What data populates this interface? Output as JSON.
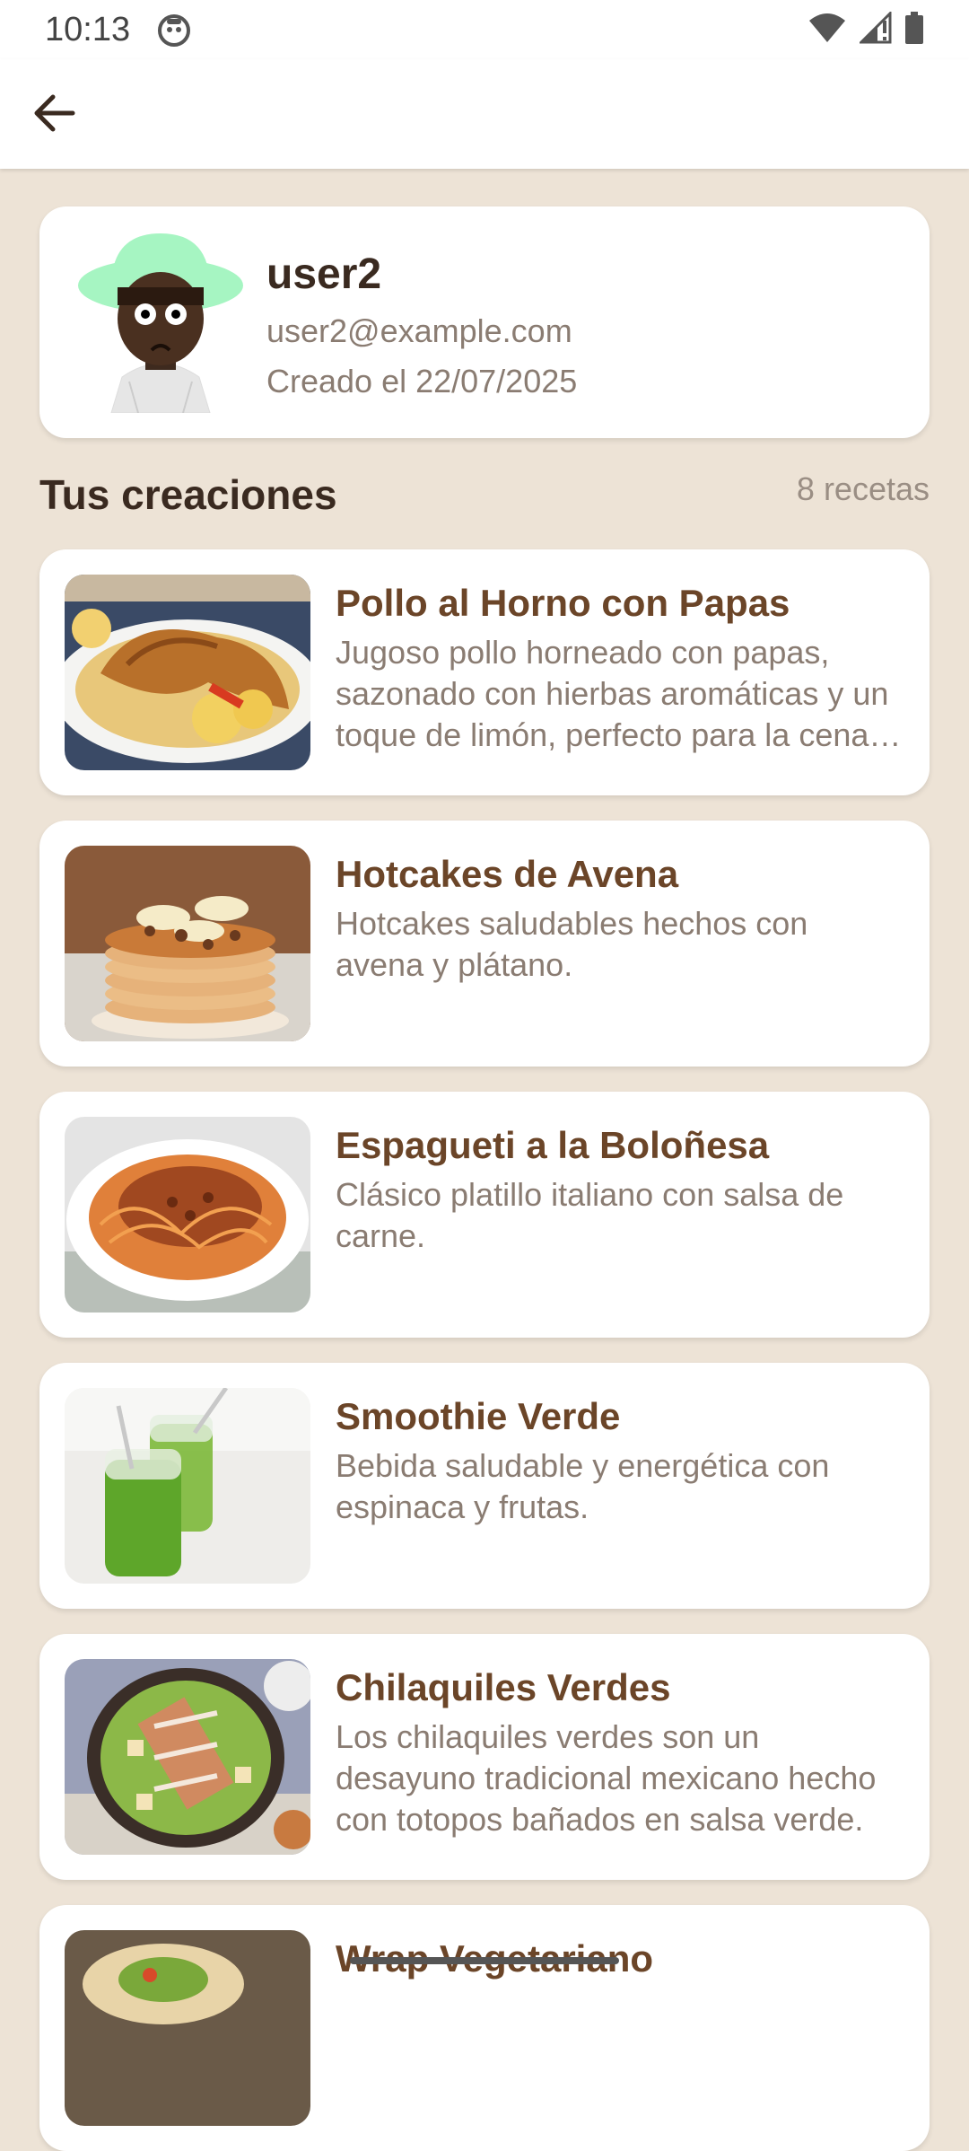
{
  "status_bar": {
    "time": "10:13",
    "icons": [
      "app-notification-icon",
      "wifi-icon",
      "signal-icon",
      "battery-icon"
    ]
  },
  "app_bar": {
    "back_icon": "arrow-back-icon"
  },
  "profile": {
    "username": "user2",
    "email": "user2@example.com",
    "created": "Creado el 22/07/2025"
  },
  "section": {
    "title": "Tus creaciones",
    "count": "8 recetas"
  },
  "recipes": [
    {
      "title": "Pollo al Horno con Papas",
      "description": "Jugoso pollo horneado con papas, sazonado con hierbas aromáticas y un toque de limón, perfecto para la cena familiar."
    },
    {
      "title": "Hotcakes de Avena",
      "description": "Hotcakes saludables hechos con avena y plátano."
    },
    {
      "title": "Espagueti a la Boloñesa",
      "description": "Clásico platillo italiano con salsa de carne."
    },
    {
      "title": "Smoothie Verde",
      "description": "Bebida saludable y energética con espinaca y frutas."
    },
    {
      "title": "Chilaquiles Verdes",
      "description": "Los chilaquiles verdes son un desayuno tradicional mexicano hecho con totopos bañados en salsa verde."
    },
    {
      "title": "Wrap Vegetariano",
      "description": ""
    }
  ],
  "colors": {
    "background": "#EDE3D6",
    "card": "#FFFFFF",
    "title_brown": "#6B4528",
    "text_dark": "#3A2A20",
    "text_muted": "#8A7C72"
  }
}
